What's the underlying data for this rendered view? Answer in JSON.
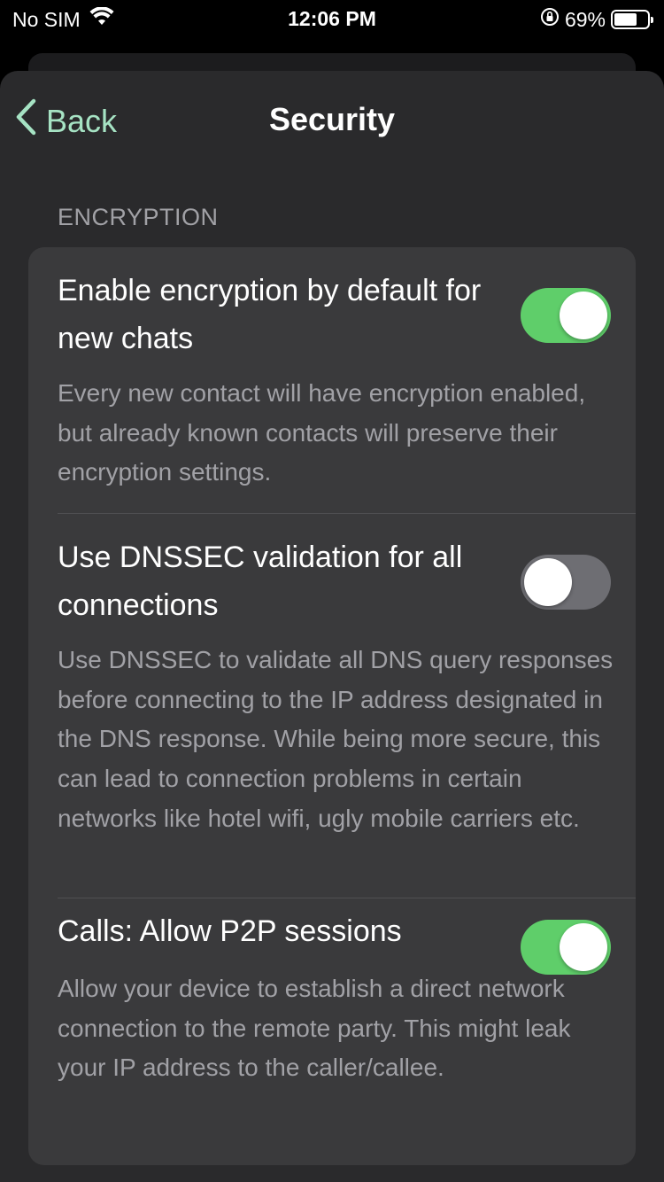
{
  "status_bar": {
    "carrier": "No SIM",
    "time": "12:06 PM",
    "battery_percent_label": "69%",
    "battery_level": 0.69,
    "icons": [
      "wifi-icon",
      "orientation-lock-icon",
      "battery-icon"
    ]
  },
  "nav": {
    "back_label": "Back",
    "title": "Security"
  },
  "section": {
    "header": "ENCRYPTION"
  },
  "settings": [
    {
      "title": "Enable encryption by default for new chats",
      "description": "Every new contact will have encryption enabled, but already known contacts will preserve their encryption settings.",
      "enabled": true
    },
    {
      "title": "Use DNSSEC validation for all connections",
      "description": "Use DNSSEC to validate all DNS query responses before connecting to the IP address designated in the DNS response. While being more secure, this can lead to connection problems in certain networks like hotel wifi, ugly mobile carriers etc.",
      "enabled": false
    },
    {
      "title": "Calls: Allow P2P sessions",
      "description": "Allow your device to establish a direct network connection to the remote party. This might leak your IP address to the caller/callee.",
      "enabled": true
    }
  ],
  "colors": {
    "accent": "#a6e3c4",
    "toggle_on": "#5fce6a",
    "toggle_off": "#6e6e73",
    "background": "#2a2a2c",
    "group_background": "#3a3a3c"
  }
}
